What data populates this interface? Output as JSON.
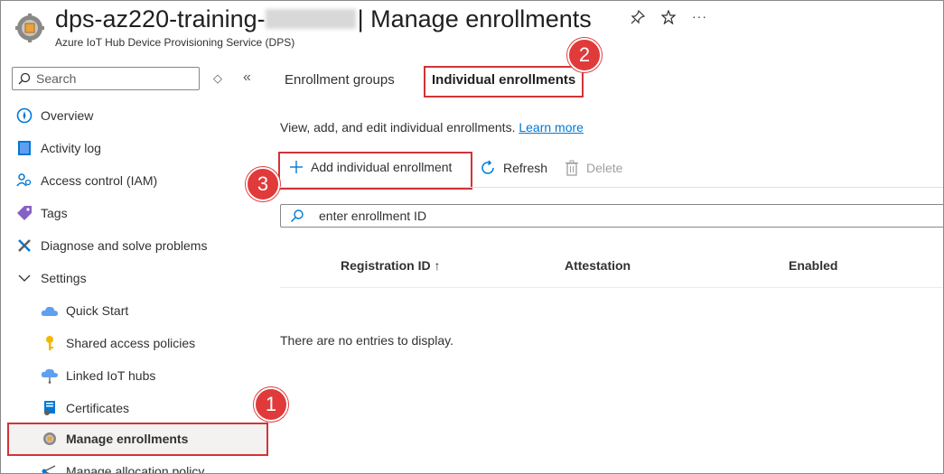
{
  "header": {
    "title": "dps-az220-training-",
    "title_suffix": "| Manage enrollments",
    "subtitle": "Azure IoT Hub Device Provisioning Service (DPS)",
    "pin_icon": "pin-icon",
    "star_icon": "star-icon",
    "more_icon": "ellipsis-icon"
  },
  "sidebar": {
    "search_placeholder": "Search",
    "items": [
      {
        "label": "Overview",
        "icon": "overview-icon"
      },
      {
        "label": "Activity log",
        "icon": "activity-log-icon"
      },
      {
        "label": "Access control (IAM)",
        "icon": "iam-icon"
      },
      {
        "label": "Tags",
        "icon": "tag-icon"
      },
      {
        "label": "Diagnose and solve problems",
        "icon": "wrench-icon"
      },
      {
        "label": "Settings",
        "icon": "chevron-down-icon"
      },
      {
        "label": "Quick Start",
        "icon": "cloud-icon"
      },
      {
        "label": "Shared access policies",
        "icon": "key-icon"
      },
      {
        "label": "Linked IoT hubs",
        "icon": "linked-hub-icon"
      },
      {
        "label": "Certificates",
        "icon": "certificate-icon"
      },
      {
        "label": "Manage enrollments",
        "icon": "gear-icon",
        "selected": true
      },
      {
        "label": "Manage allocation policy",
        "icon": "allocation-icon"
      }
    ]
  },
  "tabs": [
    {
      "label": "Enrollment groups",
      "active": false
    },
    {
      "label": "Individual enrollments",
      "active": true
    }
  ],
  "main": {
    "description": "View, add, and edit individual enrollments.",
    "learn_more": "Learn more",
    "toolbar": {
      "add_label": "Add individual enrollment",
      "refresh_label": "Refresh",
      "delete_label": "Delete"
    },
    "filter_placeholder": "enter enrollment ID",
    "columns": [
      "Registration ID ↑",
      "Attestation",
      "Enabled"
    ],
    "empty_message": "There are no entries to display."
  },
  "callouts": [
    "1",
    "2",
    "3"
  ],
  "colors": {
    "accent": "#0078d4",
    "callout": "#e03a3a"
  }
}
